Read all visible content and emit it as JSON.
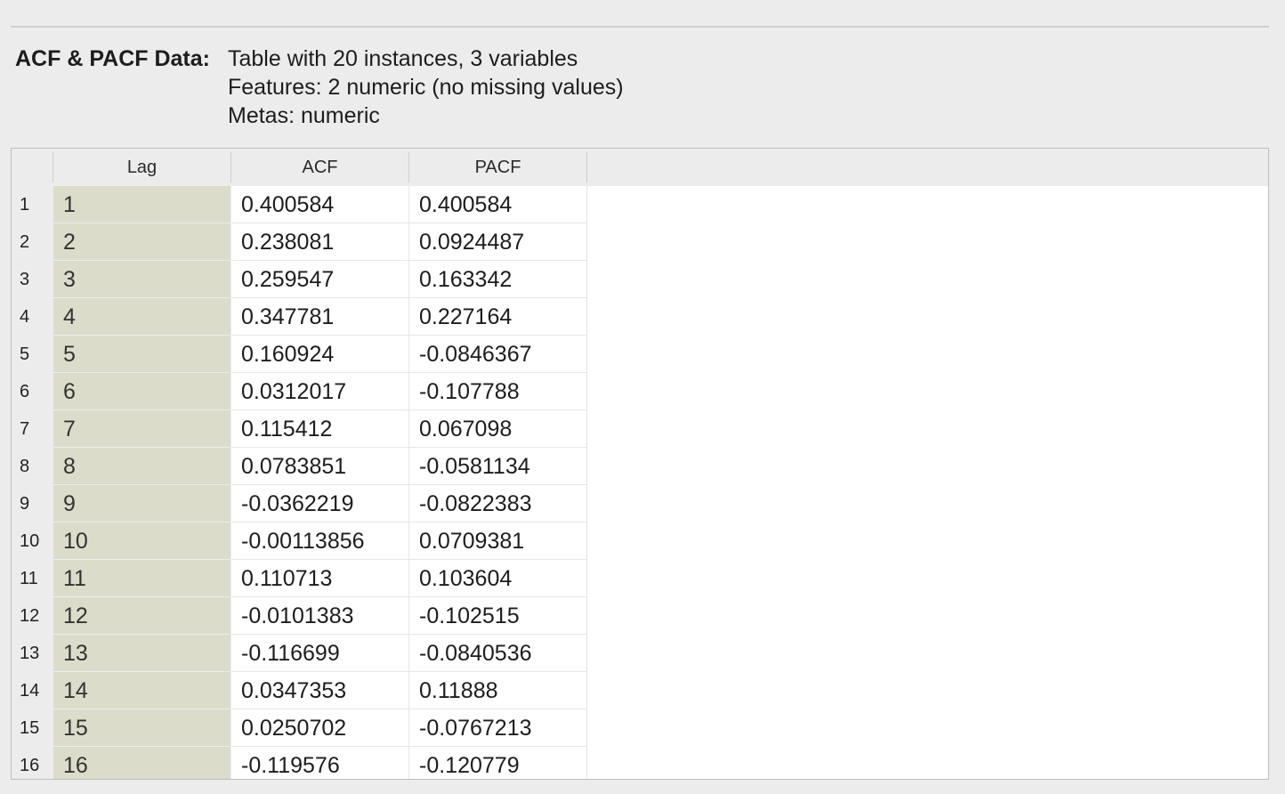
{
  "info": {
    "label": "ACF & PACF Data:",
    "line1": "Table with 20 instances, 3 variables",
    "line2": "Features: 2 numeric (no missing values)",
    "line3": "Metas: numeric"
  },
  "table": {
    "columns": [
      "Lag",
      "ACF",
      "PACF"
    ],
    "rows": [
      {
        "n": "1",
        "lag": "1",
        "acf": "0.400584",
        "pacf": "0.400584"
      },
      {
        "n": "2",
        "lag": "2",
        "acf": "0.238081",
        "pacf": "0.0924487"
      },
      {
        "n": "3",
        "lag": "3",
        "acf": "0.259547",
        "pacf": "0.163342"
      },
      {
        "n": "4",
        "lag": "4",
        "acf": "0.347781",
        "pacf": "0.227164"
      },
      {
        "n": "5",
        "lag": "5",
        "acf": "0.160924",
        "pacf": "-0.0846367"
      },
      {
        "n": "6",
        "lag": "6",
        "acf": "0.0312017",
        "pacf": "-0.107788"
      },
      {
        "n": "7",
        "lag": "7",
        "acf": "0.115412",
        "pacf": "0.067098"
      },
      {
        "n": "8",
        "lag": "8",
        "acf": "0.0783851",
        "pacf": "-0.0581134"
      },
      {
        "n": "9",
        "lag": "9",
        "acf": "-0.0362219",
        "pacf": "-0.0822383"
      },
      {
        "n": "10",
        "lag": "10",
        "acf": "-0.00113856",
        "pacf": "0.0709381"
      },
      {
        "n": "11",
        "lag": "11",
        "acf": "0.110713",
        "pacf": "0.103604"
      },
      {
        "n": "12",
        "lag": "12",
        "acf": "-0.0101383",
        "pacf": "-0.102515"
      },
      {
        "n": "13",
        "lag": "13",
        "acf": "-0.116699",
        "pacf": "-0.0840536"
      },
      {
        "n": "14",
        "lag": "14",
        "acf": "0.0347353",
        "pacf": "0.11888"
      },
      {
        "n": "15",
        "lag": "15",
        "acf": "0.0250702",
        "pacf": "-0.0767213"
      },
      {
        "n": "16",
        "lag": "16",
        "acf": "-0.119576",
        "pacf": "-0.120779"
      }
    ]
  }
}
